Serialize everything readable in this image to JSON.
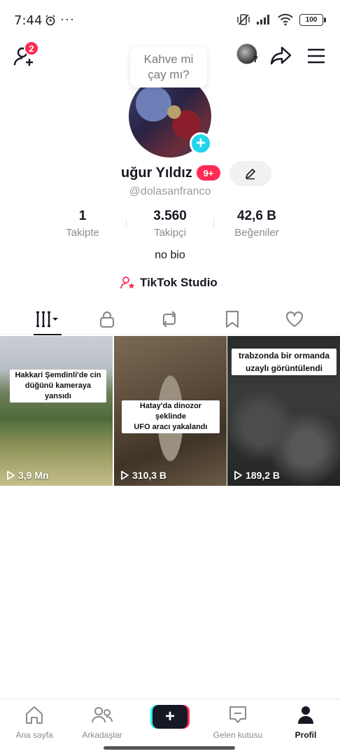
{
  "status_bar": {
    "time": "7:44",
    "more": "···",
    "battery": "100"
  },
  "header": {
    "friend_requests_badge": "2",
    "stories_count": "7"
  },
  "profile": {
    "note_bubble_line1": "Kahve mi",
    "note_bubble_line2": "çay mı?",
    "display_name": "uğur Yıldız",
    "name_badge": "9+",
    "handle": "@dolasanfranco",
    "bio": "no bio",
    "studio_link": "TikTok Studio"
  },
  "stats": [
    {
      "value": "1",
      "label": "Takipte"
    },
    {
      "value": "3.560",
      "label": "Takipçi"
    },
    {
      "value": "42,6 B",
      "label": "Beğeniler"
    }
  ],
  "videos": [
    {
      "caption_line1": "Hakkari Şemdinli'de cin",
      "caption_line2": "düğünü kameraya yansıdı",
      "views": "3,9 Mn"
    },
    {
      "caption_line1": "Hatay'da dinozor şeklinde",
      "caption_line2": "UFO aracı yakalandı",
      "views": "310,3 B"
    },
    {
      "caption_line1": "trabzonda bir ormanda",
      "caption_line2": "uzaylı görüntülendi",
      "views": "189,2 B"
    }
  ],
  "bottom_nav": [
    {
      "label": "Ana sayfa"
    },
    {
      "label": "Arkadaşlar"
    },
    {
      "label": "Gelen kutusu"
    },
    {
      "label": "Profil"
    }
  ],
  "colors": {
    "accent": "#fe2c55",
    "cyan": "#20d5ec",
    "text": "#161823",
    "muted": "#8a8b91"
  }
}
